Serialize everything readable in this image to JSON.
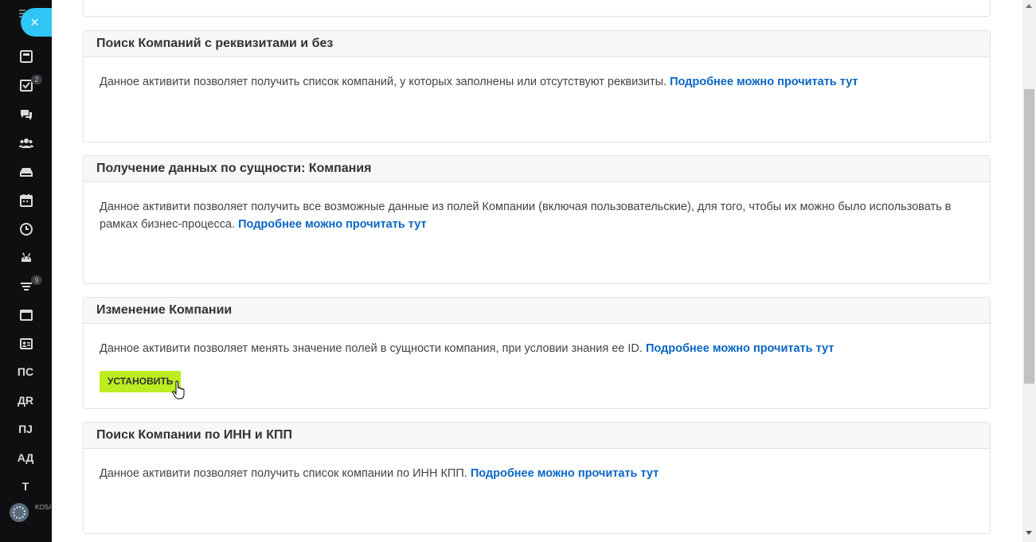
{
  "sidebar": {
    "close_label": "×",
    "badges": {
      "tasks": "2",
      "filter": "9"
    },
    "text_items": [
      "ПС",
      "ДR",
      "ПJ",
      "АД",
      "Т"
    ],
    "user_label": "KOSA ВСЁ Б"
  },
  "cards": [
    {
      "title": "",
      "text": "",
      "link": ""
    },
    {
      "title": "Поиск Компаний с реквизитами и без",
      "text": "Данное активити позволяет получить список компаний, у которых заполнены или отсутствуют реквизиты. ",
      "link": "Подробнее можно прочитать тут"
    },
    {
      "title": "Получение данных по сущности: Компания",
      "text": "Данное активити позволяет получить все возможные данные из полей Компании (включая пользовательские), для того, чтобы их можно было использовать в рамках бизнес-процесса. ",
      "link": "Подробнее можно прочитать тут"
    },
    {
      "title": "Изменение Компании",
      "text": "Данное активити позволяет менять значение полей в сущности компания, при условии знания ее ID. ",
      "link": "Подробнее можно прочитать тут",
      "button": "УСТАНОВИТЬ"
    },
    {
      "title": "Поиск Компании по ИНН и КПП",
      "text": "Данное активити позволяет получить список компании по ИНН КПП. ",
      "link": "Подробнее можно прочитать тут"
    }
  ],
  "colors": {
    "accent_button": "#bbed21",
    "link": "#0b66c3",
    "close": "#2fc6f6"
  }
}
